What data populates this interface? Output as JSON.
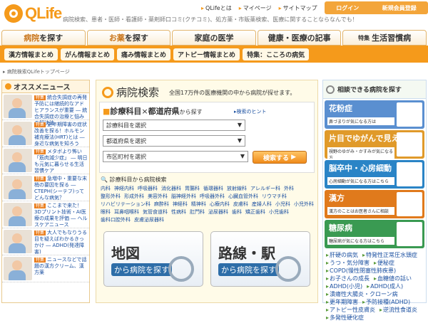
{
  "header": {
    "logo": "QLife",
    "tagline": "病院検索、患者・医師・看護師・薬剤師口コミ(クチコミ)、処方薬・市販薬検索、医療に関することならなんでも！",
    "toplinks": [
      "QLifeとは",
      "マイページ",
      "サイトマップ"
    ],
    "login": "ログイン",
    "register": "新規会員登録"
  },
  "mainnav": [
    {
      "em": "病院",
      "rest": "を探す"
    },
    {
      "em": "お薬",
      "rest": "を探す"
    },
    {
      "em": "",
      "rest": "家庭の医学"
    },
    {
      "em": "",
      "rest": "健康・医療の記事"
    },
    {
      "em": "特集",
      "rest": "生活習慣病"
    }
  ],
  "subnav": [
    "漢方情報まとめ",
    "がん情報まとめ",
    "痛み情報まとめ",
    "アトピー情報まとめ",
    "特集：こころの病気"
  ],
  "breadcrumb": "病院検索QLifeトップページ",
  "recommend": {
    "title": "オススメニュース",
    "items": [
      {
        "tag": "特集",
        "text": "統合失調症の再発予防には継続的なアドヒアランスが重要 ― 統合失調症の治療と悩みの解決法"
      },
      {
        "tag": "特集",
        "text": "更年期障害の症状改善を探る！ホルモン補充療法(HRT)とは ― 身近な病気を知ろう"
      },
      {
        "tag": "特集",
        "text": "メタボより怖い「筋肉減少症」 ― 明日も元気に暮らせる生活習慣ケア"
      },
      {
        "tag": "特集",
        "text": "急増中・重要な末梢の要因を探る ― CTEPH(シーテフ)ってどんな病気？"
      },
      {
        "tag": "特集",
        "text": "ここまで来た！3Dプリント技術・AI医療の成果を評価 ― ヘルスケアニュース"
      },
      {
        "tag": "特集",
        "text": "大人でもなりうる目を疑えばわかるきっかけ ― ADHD(発達障害)"
      },
      {
        "tag": "特集",
        "text": "ニュースなどで話題の漢方クリーム、漢方薬"
      }
    ]
  },
  "search": {
    "title": "病院検索",
    "subtitle": "全国17万件の医療機関の中から病院が探せます。",
    "head_a": "診療科目",
    "head_x": "×",
    "head_b": "都道府県",
    "head_c": "から探す",
    "hint": "▸検索のヒント",
    "sel1": "診療科目を選択",
    "sel2": "都道府県を選択",
    "sel3": "市区町村を選択",
    "button": "検索する",
    "cat_title": "診療科目から病院検索",
    "categories": [
      "内科",
      "神経内科",
      "呼吸器科",
      "消化器科",
      "胃腸科",
      "循環器科",
      "放射線科",
      "アレルギー科",
      "外科",
      "整形外科",
      "形成外科",
      "美容外科",
      "脳神経外科",
      "呼吸器外科",
      "心臓血管外科",
      "リウマチ科",
      "リハビリテーション科",
      "麻酔科",
      "神経科",
      "精神科",
      "心療内科",
      "皮膚科",
      "産婦人科",
      "小児科",
      "小児外科",
      "眼科",
      "耳鼻咽喉科",
      "気管食道科",
      "性病科",
      "肛門科",
      "泌尿器科",
      "歯科",
      "矯正歯科",
      "小児歯科",
      "歯科口腔外科",
      "皮膚泌尿器科"
    ],
    "map_big": "地図",
    "map_small": "から病院を探す",
    "rail_big": "路線・駅",
    "rail_small": "から病院を探す"
  },
  "right": {
    "title": "相談できる病院を探す",
    "diseases": [
      {
        "name": "花粉症",
        "desc": "鼻づまりが気になる方は",
        "color": "#5a8fd0"
      },
      {
        "name": "片目でゆがんで見える",
        "desc": "視野のゆがみ・かすみが気になる方",
        "color": "#e09a2a"
      },
      {
        "name": "脳卒中・心房細動",
        "desc": "心房細動が気になる方はこちら",
        "color": "#2a84c6"
      },
      {
        "name": "漢方",
        "desc": "漢方のことはお医者さんに相談",
        "color": "#e07a1c"
      },
      {
        "name": "糖尿病",
        "desc": "糖尿病が気になる方はこちら",
        "color": "#3a9a52"
      }
    ],
    "links": [
      "肝硬の病気",
      "特発性正常圧水頭症",
      "うつ・気分障害",
      "便秘症",
      "COPD(慢性閉塞性肺疾患)",
      "お子さんの成長",
      "血糖値の話い",
      "ADHD(小児)",
      "ADHD(成人)",
      "潰瘍性大腸炎・クローン病",
      "更年期障害",
      "予防接種(ADHD)",
      "アトピー性皮膚炎",
      "逆流性食道炎",
      "多発性硬化症"
    ]
  }
}
